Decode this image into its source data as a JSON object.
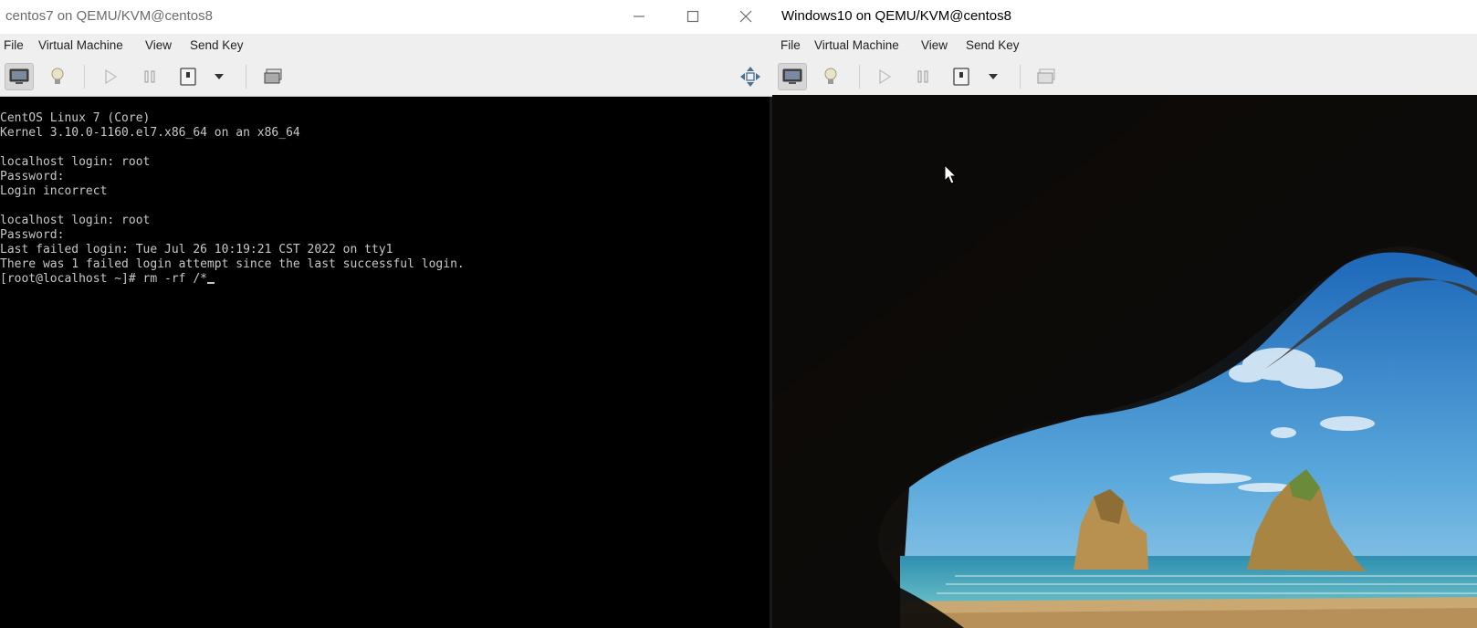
{
  "colors": {
    "titlebar_bg": "#ffffff",
    "menubar_bg": "#efefef",
    "console_bg": "#000000",
    "console_fg": "#c8c8c8",
    "sky": "#2d7fc4",
    "cave": "#141210",
    "rock": "#b8904f",
    "sea": "#3ca0b8",
    "sand": "#c9a872"
  },
  "left_window": {
    "title": "centos7 on QEMU/KVM@centos8",
    "window_controls": {
      "minimize": "minimize-icon",
      "maximize": "maximize-icon",
      "close": "close-icon"
    },
    "menu": [
      "File",
      "Virtual Machine",
      "View",
      "Send Key"
    ],
    "toolbar": {
      "items": [
        "console-icon",
        "lightbulb-icon",
        "play-icon",
        "pause-icon",
        "power-icon",
        "chevron-down-icon",
        "snapshot-icon",
        "fullscreen-move-icon"
      ]
    },
    "terminal": {
      "lines": [
        "CentOS Linux 7 (Core)",
        "Kernel 3.10.0-1160.el7.x86_64 on an x86_64",
        "",
        "localhost login: root",
        "Password:",
        "Login incorrect",
        "",
        "localhost login: root",
        "Password:",
        "Last failed login: Tue Jul 26 10:19:21 CST 2022 on tty1",
        "There was 1 failed login attempt since the last successful login.",
        "[root@localhost ~]# rm -rf /*"
      ]
    }
  },
  "right_window": {
    "title": "Windows10 on QEMU/KVM@centos8",
    "menu": [
      "File",
      "Virtual Machine",
      "View",
      "Send Key"
    ],
    "toolbar": {
      "items": [
        "console-icon",
        "lightbulb-icon",
        "play-icon",
        "pause-icon",
        "power-icon",
        "chevron-down-icon",
        "snapshot-icon"
      ]
    },
    "desktop": {
      "wallpaper": "windows-10-cave-beach-wallpaper",
      "pointer": "mouse-pointer-icon"
    }
  }
}
